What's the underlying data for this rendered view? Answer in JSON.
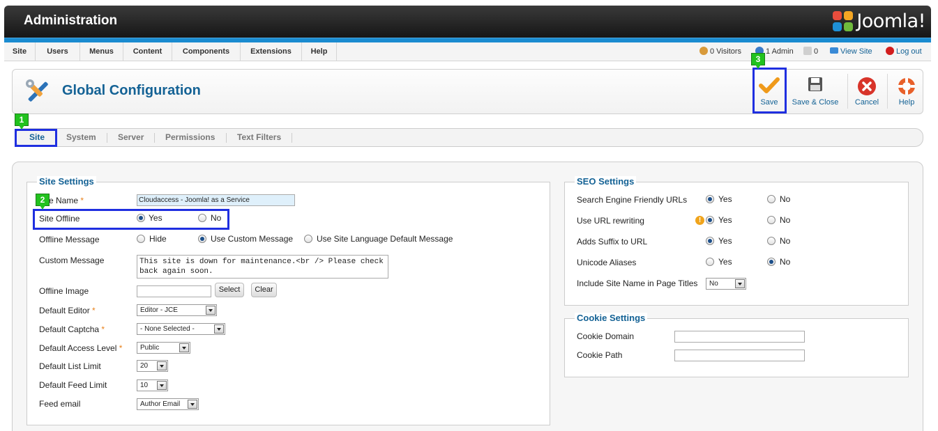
{
  "header": {
    "title": "Administration",
    "logo_text": "Joomla!"
  },
  "menu": {
    "items": [
      "Site",
      "Users",
      "Menus",
      "Content",
      "Components",
      "Extensions",
      "Help"
    ],
    "status": {
      "visitors": "0 Visitors",
      "admins": "1 Admin",
      "messages": "0",
      "view_site": "View Site",
      "logout": "Log out"
    }
  },
  "toolbar": {
    "title": "Global Configuration",
    "buttons": {
      "save": "Save",
      "save_close": "Save & Close",
      "cancel": "Cancel",
      "help": "Help"
    }
  },
  "tabs": [
    "Site",
    "System",
    "Server",
    "Permissions",
    "Text Filters"
  ],
  "active_tab": "Site",
  "annotations": {
    "badge1": "1",
    "badge2": "2",
    "badge3": "3"
  },
  "site_settings": {
    "legend": "Site Settings",
    "site_name": {
      "label": "Site Name",
      "value": "Cloudaccess - Joomla! as a Service"
    },
    "site_offline": {
      "label": "Site Offline",
      "yes": "Yes",
      "no": "No",
      "selected": "Yes"
    },
    "offline_message": {
      "label": "Offline Message",
      "hide": "Hide",
      "custom": "Use Custom Message",
      "language": "Use Site Language Default Message",
      "selected": "Use Custom Message"
    },
    "custom_message": {
      "label": "Custom Message",
      "value": "This site is down for maintenance.<br /> Please check back again soon."
    },
    "offline_image": {
      "label": "Offline Image",
      "value": "",
      "select": "Select",
      "clear": "Clear"
    },
    "default_editor": {
      "label": "Default Editor",
      "value": "Editor - JCE"
    },
    "default_captcha": {
      "label": "Default Captcha",
      "value": "- None Selected -"
    },
    "default_access": {
      "label": "Default Access Level",
      "value": "Public"
    },
    "list_limit": {
      "label": "Default List Limit",
      "value": "20"
    },
    "feed_limit": {
      "label": "Default Feed Limit",
      "value": "10"
    },
    "feed_email": {
      "label": "Feed email",
      "value": "Author Email"
    }
  },
  "seo_settings": {
    "legend": "SEO Settings",
    "sef_urls": {
      "label": "Search Engine Friendly URLs",
      "yes": "Yes",
      "no": "No",
      "selected": "Yes"
    },
    "url_rewriting": {
      "label": "Use URL rewriting",
      "yes": "Yes",
      "no": "No",
      "selected": "Yes"
    },
    "suffix": {
      "label": "Adds Suffix to URL",
      "yes": "Yes",
      "no": "No",
      "selected": "Yes"
    },
    "unicode": {
      "label": "Unicode Aliases",
      "yes": "Yes",
      "no": "No",
      "selected": "No"
    },
    "site_name_titles": {
      "label": "Include Site Name in Page Titles",
      "value": "No"
    }
  },
  "cookie_settings": {
    "legend": "Cookie Settings",
    "domain": {
      "label": "Cookie Domain",
      "value": ""
    },
    "path": {
      "label": "Cookie Path",
      "value": ""
    }
  },
  "colors": {
    "accent": "#146295",
    "highlight": "#1f2fe0",
    "badge": "#22c21e",
    "required": "#e8801a"
  }
}
